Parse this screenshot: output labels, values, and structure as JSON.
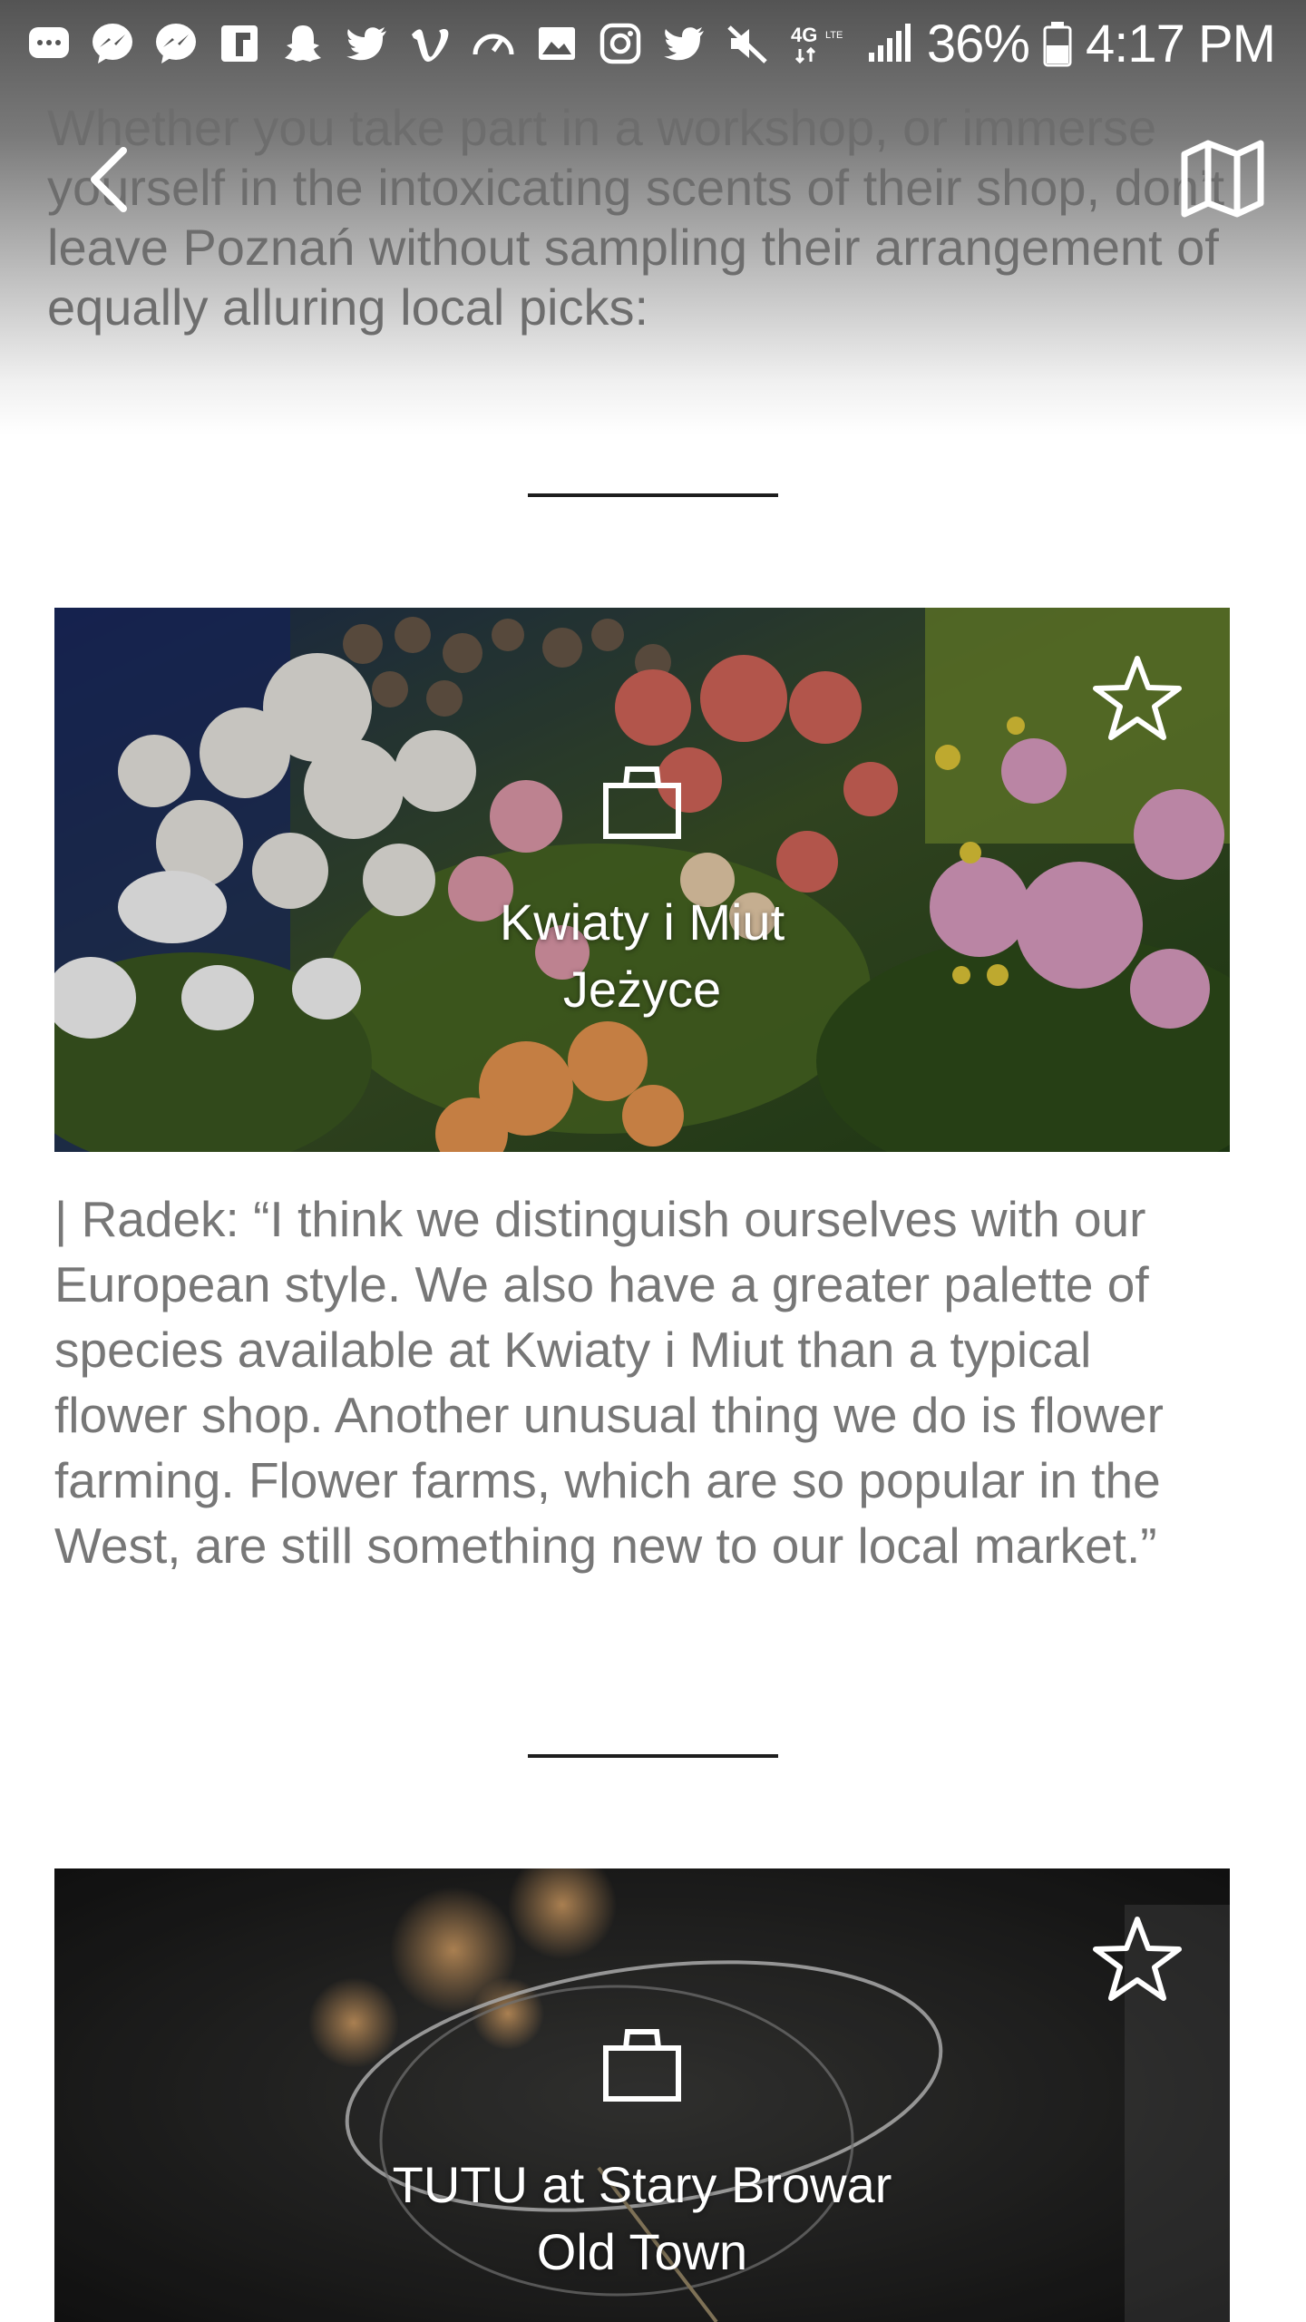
{
  "status_bar": {
    "battery": "36%",
    "time": "4:17 PM",
    "network": "4G LTE",
    "icons": [
      "chat-icon",
      "messenger-icon",
      "messenger-icon",
      "flipboard-icon",
      "snapchat-icon",
      "twitter-icon",
      "vimeo-icon",
      "speedometer-icon",
      "gallery-icon",
      "instagram-icon",
      "twitter-icon",
      "mute-icon"
    ]
  },
  "intro": {
    "text": "Whether you take part in a workshop, or immerse yourself in the intoxicating scents of their shop, don’t leave Poznań without sampling their arrangement of equally alluring local picks:"
  },
  "nav": {
    "back_icon": "chevron-left-icon",
    "map_icon": "map-icon"
  },
  "cards": [
    {
      "name": "Kwiaty i Miut",
      "district": "Jeżyce",
      "category_icon": "shopping-bag-icon",
      "favorite_icon": "star-outline-icon"
    },
    {
      "name": "TUTU at Stary Browar",
      "district": "Old Town",
      "category_icon": "shopping-bag-icon",
      "favorite_icon": "star-outline-icon"
    }
  ],
  "quote": {
    "text": "| Radek: “I think we distinguish ourselves with our European style. We also have a greater palette of species available at Kwiaty i Miut than a typical flower shop. Another unusual thing we do is flower farming. Flower farms, which are so popular in the West, are still something new to our local market.”"
  },
  "colors": {
    "text_gray": "#777777",
    "divider": "#1e1e1e",
    "overlay_text": "#ffffff"
  }
}
